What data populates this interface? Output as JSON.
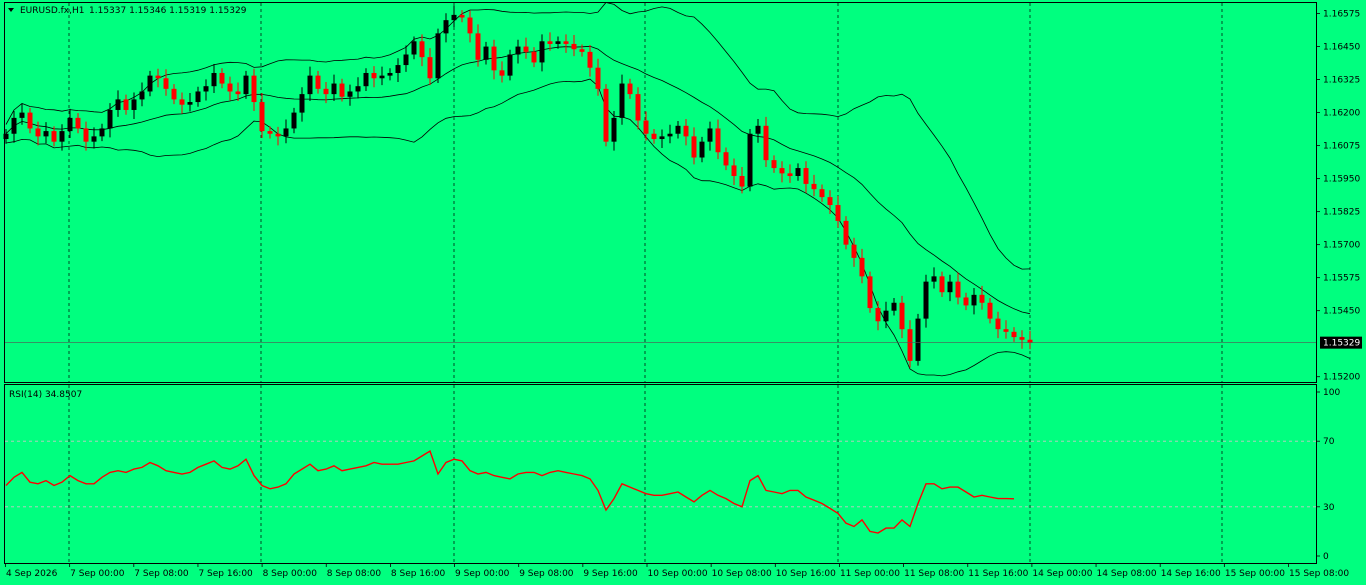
{
  "header": {
    "menu_icon": "triangle-down-icon",
    "symbol": "EURUSD.fx,H1",
    "ohlc": "1.15337 1.15346 1.15319 1.15329"
  },
  "current_price_label": "1.15329",
  "rsi_header": "RSI(14) 34.8507",
  "colors": {
    "background": "#00ff7f",
    "bull": "#000000",
    "bear": "#ff0000",
    "rsi_line": "#ff0000",
    "grid": "#000000"
  },
  "chart_data": [
    {
      "type": "candlestick",
      "title": "EURUSD.fx,H1",
      "ylim": [
        1.1518,
        1.16615
      ],
      "price_ticks": [
        "1.16575",
        "1.16450",
        "1.16325",
        "1.16200",
        "1.16075",
        "1.15950",
        "1.15825",
        "1.15700",
        "1.15575",
        "1.15450",
        "1.15200"
      ],
      "time_labels": [
        "4 Sep 2026",
        "7 Sep 00:00",
        "7 Sep 08:00",
        "7 Sep 16:00",
        "8 Sep 00:00",
        "8 Sep 08:00",
        "8 Sep 16:00",
        "9 Sep 00:00",
        "9 Sep 08:00",
        "9 Sep 16:00",
        "10 Sep 00:00",
        "10 Sep 08:00",
        "10 Sep 16:00",
        "11 Sep 00:00",
        "11 Sep 08:00",
        "11 Sep 16:00",
        "14 Sep 00:00",
        "14 Sep 08:00",
        "14 Sep 16:00",
        "15 Sep 00:00",
        "15 Sep 08:00"
      ],
      "last_price": 1.15329,
      "close": [
        1.1612,
        1.1618,
        1.162,
        1.1614,
        1.1611,
        1.1613,
        1.1609,
        1.1613,
        1.1618,
        1.1614,
        1.1609,
        1.1611,
        1.1614,
        1.1621,
        1.1625,
        1.1621,
        1.1625,
        1.1628,
        1.1634,
        1.1633,
        1.1629,
        1.1625,
        1.1623,
        1.1624,
        1.1628,
        1.163,
        1.1635,
        1.1631,
        1.1628,
        1.1627,
        1.1634,
        1.1624,
        1.1613,
        1.1612,
        1.1611,
        1.1614,
        1.162,
        1.1627,
        1.1634,
        1.1629,
        1.1627,
        1.1631,
        1.1626,
        1.1628,
        1.163,
        1.1635,
        1.1633,
        1.1634,
        1.1635,
        1.1638,
        1.1642,
        1.1647,
        1.1641,
        1.1633,
        1.165,
        1.1655,
        1.1657,
        1.1656,
        1.165,
        1.164,
        1.1645,
        1.1636,
        1.1634,
        1.1642,
        1.1645,
        1.1643,
        1.1639,
        1.1647,
        1.1646,
        1.1647,
        1.1646,
        1.1644,
        1.1643,
        1.1637,
        1.1629,
        1.1609,
        1.1618,
        1.1631,
        1.1627,
        1.1617,
        1.1612,
        1.161,
        1.1611,
        1.1612,
        1.1615,
        1.1611,
        1.1603,
        1.1609,
        1.1614,
        1.1605,
        1.16,
        1.1596,
        1.1592,
        1.1612,
        1.1615,
        1.1602,
        1.1599,
        1.1597,
        1.1596,
        1.1599,
        1.1593,
        1.1591,
        1.1588,
        1.1585,
        1.1579,
        1.157,
        1.1565,
        1.1558,
        1.1546,
        1.1541,
        1.1545,
        1.1548,
        1.1538,
        1.1526,
        1.1542,
        1.1556,
        1.1558,
        1.1552,
        1.1556,
        1.155,
        1.1547,
        1.1551,
        1.1548,
        1.1542,
        1.1538,
        1.1537,
        1.1535,
        1.1534,
        1.1533
      ],
      "series": [
        {
          "name": "RSI(14)",
          "ylim": [
            0,
            100
          ],
          "ticks": [
            "100",
            "70",
            "30",
            "0"
          ],
          "levels": [
            70,
            30
          ],
          "last_value": 34.8507,
          "values": [
            43,
            48,
            51,
            45,
            44,
            46,
            43,
            45,
            49,
            46,
            44,
            44,
            48,
            51,
            52,
            51,
            53,
            54,
            57,
            55,
            52,
            51,
            50,
            51,
            54,
            56,
            58,
            54,
            53,
            55,
            59,
            49,
            43,
            41,
            42,
            44,
            50,
            53,
            56,
            52,
            53,
            55,
            52,
            53,
            54,
            55,
            57,
            56,
            56,
            56,
            57,
            58,
            61,
            64,
            50,
            57,
            59,
            58,
            52,
            50,
            51,
            49,
            48,
            47,
            50,
            51,
            51,
            49,
            51,
            52,
            51,
            50,
            49,
            47,
            40,
            28,
            35,
            44,
            42,
            40,
            38,
            37,
            37,
            38,
            39,
            36,
            33,
            37,
            40,
            37,
            35,
            32,
            30,
            46,
            49,
            40,
            39,
            38,
            40,
            40,
            36,
            34,
            32,
            29,
            26,
            20,
            18,
            22,
            15,
            14,
            17,
            17,
            22,
            18,
            32,
            44,
            44,
            41,
            42,
            42,
            39,
            36,
            37,
            36,
            35,
            35,
            34.85
          ]
        }
      ]
    }
  ]
}
